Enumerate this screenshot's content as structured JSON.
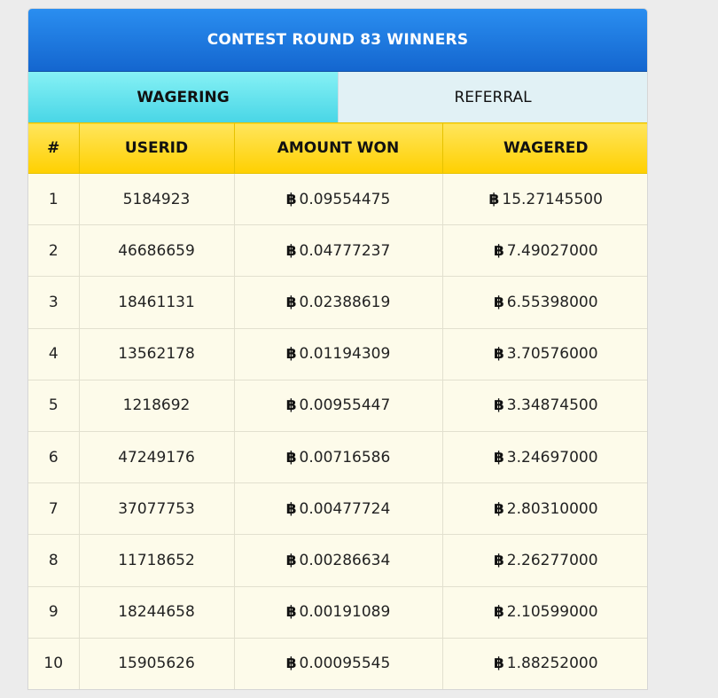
{
  "header": {
    "title": "CONTEST ROUND 83 WINNERS"
  },
  "tabs": [
    {
      "label": "WAGERING",
      "active": true
    },
    {
      "label": "REFERRAL",
      "active": false
    }
  ],
  "table": {
    "columns": [
      "#",
      "USERID",
      "AMOUNT WON",
      "WAGERED"
    ],
    "currency_symbol": "฿",
    "rows": [
      {
        "rank": "1",
        "userid": "5184923",
        "amount_won": "0.09554475",
        "wagered": "15.27145500"
      },
      {
        "rank": "2",
        "userid": "46686659",
        "amount_won": "0.04777237",
        "wagered": "7.49027000"
      },
      {
        "rank": "3",
        "userid": "18461131",
        "amount_won": "0.02388619",
        "wagered": "6.55398000"
      },
      {
        "rank": "4",
        "userid": "13562178",
        "amount_won": "0.01194309",
        "wagered": "3.70576000"
      },
      {
        "rank": "5",
        "userid": "1218692",
        "amount_won": "0.00955447",
        "wagered": "3.34874500"
      },
      {
        "rank": "6",
        "userid": "47249176",
        "amount_won": "0.00716586",
        "wagered": "3.24697000"
      },
      {
        "rank": "7",
        "userid": "37077753",
        "amount_won": "0.00477724",
        "wagered": "2.80310000"
      },
      {
        "rank": "8",
        "userid": "11718652",
        "amount_won": "0.00286634",
        "wagered": "2.26277000"
      },
      {
        "rank": "9",
        "userid": "18244658",
        "amount_won": "0.00191089",
        "wagered": "2.10599000"
      },
      {
        "rank": "10",
        "userid": "15905626",
        "amount_won": "0.00095545",
        "wagered": "1.88252000"
      }
    ]
  },
  "colors": {
    "header_blue": "#1f7be2",
    "tab_active": "#5fdfec",
    "column_header_yellow": "#ffd800",
    "row_bg": "#fdfbea"
  }
}
